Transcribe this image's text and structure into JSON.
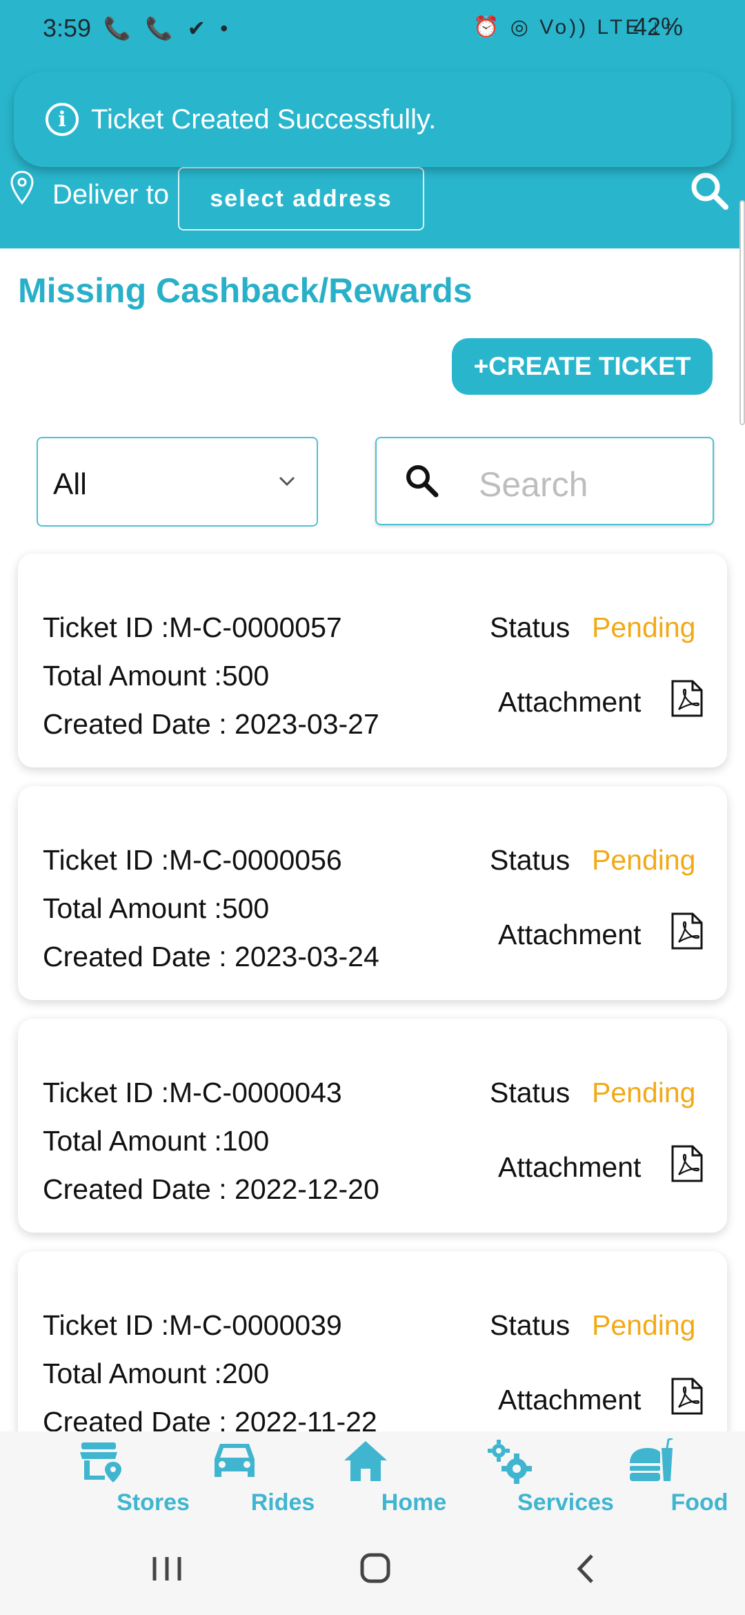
{
  "status_bar": {
    "time": "3:59",
    "left_icons": "📞 📞 ✔ •",
    "right_icons": "⏰ ◎ Vo)) LTE ↓↑",
    "battery": "42%"
  },
  "toast": {
    "message": "Ticket Created Successfully."
  },
  "header": {
    "deliver_label": "Deliver to",
    "address_button": "select address"
  },
  "page": {
    "title": "Missing Cashback/Rewards",
    "create_button": "+CREATE TICKET",
    "filter_value": "All",
    "search_placeholder": "Search"
  },
  "labels": {
    "status": "Status",
    "attachment": "Attachment"
  },
  "tickets": [
    {
      "id": "Ticket ID :M-C-0000057",
      "amount": "Total Amount :500",
      "date": "Created Date : 2023-03-27",
      "status": "Pending"
    },
    {
      "id": "Ticket ID :M-C-0000056",
      "amount": "Total Amount :500",
      "date": "Created Date : 2023-03-24",
      "status": "Pending"
    },
    {
      "id": "Ticket ID :M-C-0000043",
      "amount": "Total Amount :100",
      "date": "Created Date : 2022-12-20",
      "status": "Pending"
    },
    {
      "id": "Ticket ID :M-C-0000039",
      "amount": "Total Amount :200",
      "date": "Created Date : 2022-11-22",
      "status": "Pending"
    }
  ],
  "bottom_nav": [
    {
      "label": "Stores",
      "icon": "store-icon"
    },
    {
      "label": "Rides",
      "icon": "car-icon"
    },
    {
      "label": "Home",
      "icon": "home-icon"
    },
    {
      "label": "Services",
      "icon": "gears-icon"
    },
    {
      "label": "Food",
      "icon": "burger-drink-icon"
    }
  ],
  "colors": {
    "primary": "#29b6cd",
    "nav_text": "#3fb5cf",
    "pending": "#f2a916"
  }
}
